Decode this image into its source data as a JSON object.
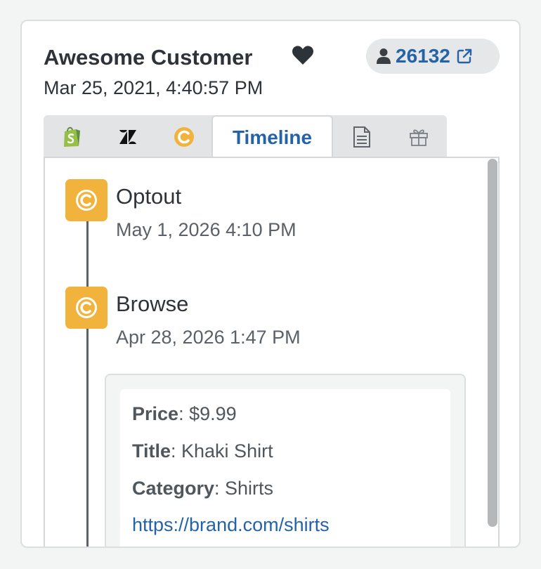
{
  "customer": {
    "name": "Awesome Customer",
    "date": "Mar 25, 2021, 4:40:57 PM",
    "id": "26132"
  },
  "tabs": {
    "active_label": "Timeline",
    "icons": [
      "shopify-icon",
      "zendesk-icon",
      "community-icon",
      "timeline",
      "document-icon",
      "gift-icon"
    ]
  },
  "timeline": {
    "events": [
      {
        "title": "Optout",
        "date": "May 1, 2026 4:10 PM"
      },
      {
        "title": "Browse",
        "date": "Apr 28, 2026 1:47 PM"
      }
    ],
    "details": {
      "price_label": "Price",
      "price_value": ": $9.99",
      "title_label": "Title",
      "title_value": ": Khaki Shirt",
      "category_label": "Category",
      "category_value": ": Shirts",
      "link": "https://brand.com/shirts"
    }
  },
  "colors": {
    "accent": "#2563a8",
    "badge": "#f2b33d",
    "shopify": "#95bf47"
  }
}
